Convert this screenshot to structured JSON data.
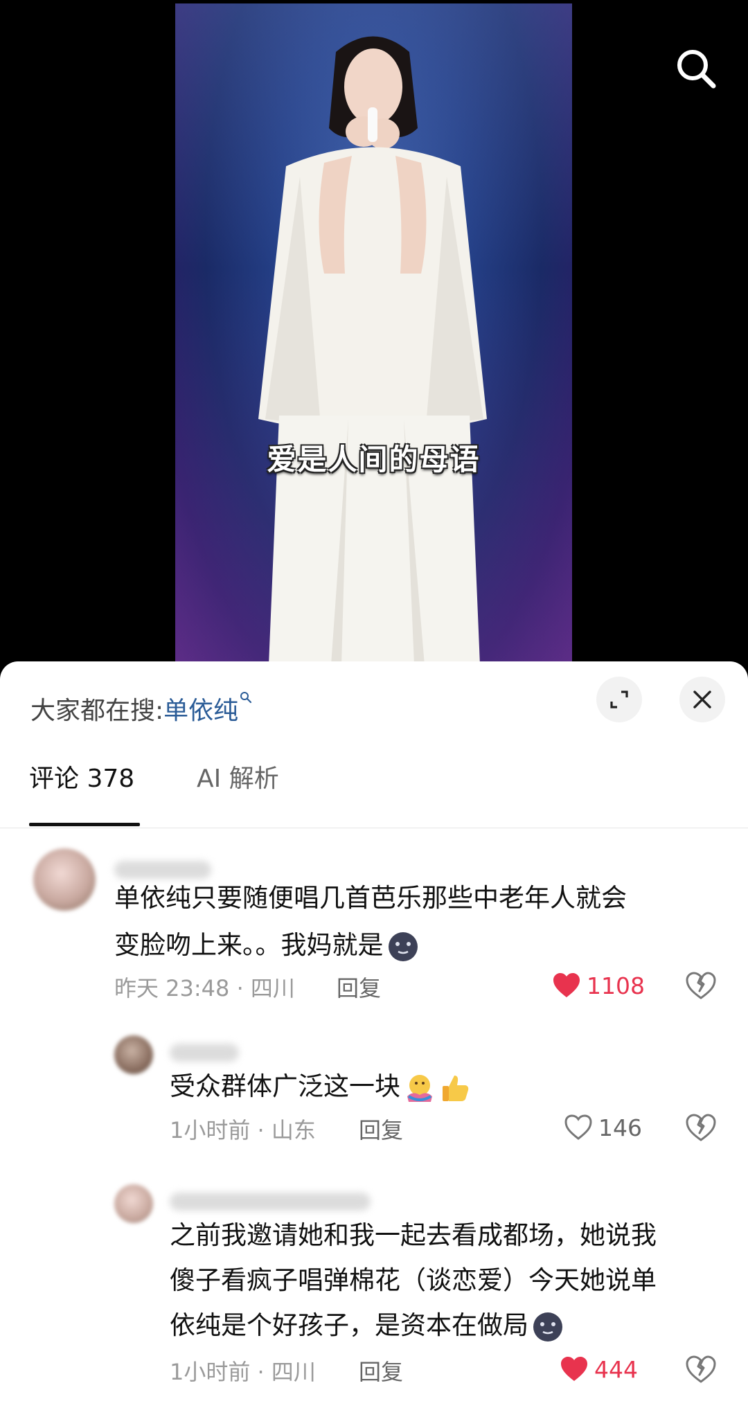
{
  "video": {
    "subtitle": "爱是人间的母语",
    "search_icon": "search-icon"
  },
  "sheet": {
    "trending": {
      "prefix": "大家都在搜:",
      "keyword": "单依纯",
      "keyword_icon": "search-mini-icon"
    },
    "expand_icon": "expand-icon",
    "close_icon": "close-icon"
  },
  "tabs": [
    {
      "label": "评论 378",
      "active": true
    },
    {
      "label": "AI 解析",
      "active": false
    }
  ],
  "comments": [
    {
      "text_lines": [
        "单依纯只要随便唱几首芭乐那些中老年人就会",
        "变脸吻上来。。我妈就是"
      ],
      "emoji": [
        "moon-face-emoji"
      ],
      "time_location": "昨天 23:48 · 四川",
      "reply_label": "回复",
      "likes": "1108",
      "liked": true
    },
    {
      "text_lines": [
        "受众群体广泛这一块"
      ],
      "emoji": [
        "hug-emoji",
        "thumbs-up-emoji"
      ],
      "time_location": "1小时前 · 山东",
      "reply_label": "回复",
      "likes": "146",
      "liked": false
    },
    {
      "text_lines": [
        "之前我邀请她和我一起去看成都场，她说我",
        "傻子看疯子唱弹棉花（谈恋爱）今天她说单",
        "依纯是个好孩子，是资本在做局"
      ],
      "emoji": [
        "moon-face-emoji"
      ],
      "time_location": "1小时前 · 四川",
      "reply_label": "回复",
      "likes": "444",
      "liked": true
    }
  ],
  "colors": {
    "accent_like": "#e8334e",
    "link_blue": "#2b5c97"
  }
}
